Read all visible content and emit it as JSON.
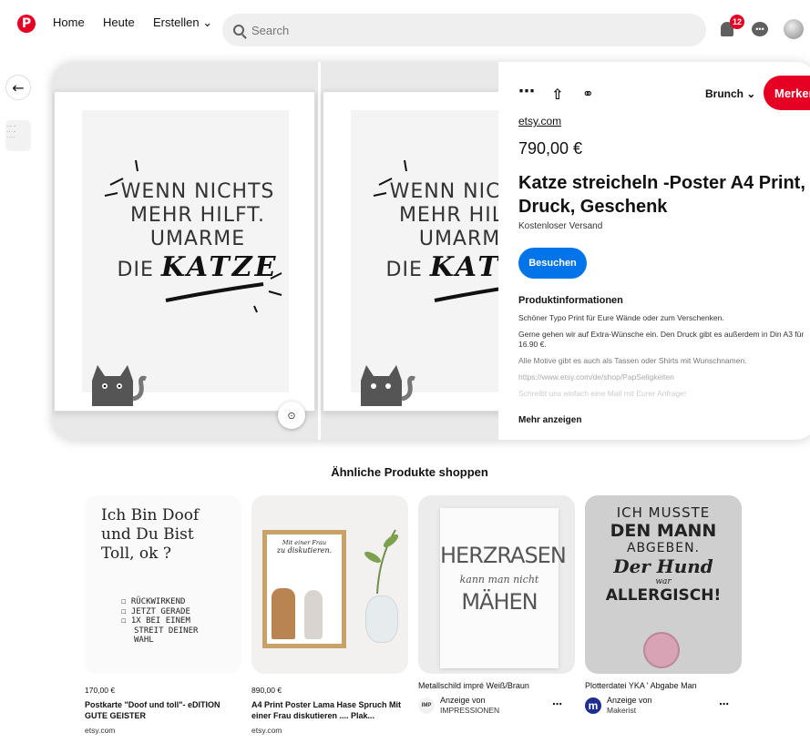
{
  "nav": {
    "home": "Home",
    "heute": "Heute",
    "erstellen": "Erstellen ⌄",
    "search_placeholder": "Search",
    "notification_count": "12"
  },
  "pin": {
    "board": "Brunch ⌄",
    "save": "Merken",
    "source": "etsy.com",
    "price": "790,00 €",
    "title": "Katze streicheln -Poster A4 Print, Druck, Geschenk",
    "shipping": "Kostenloser Versand",
    "visit": "Besuchen",
    "product_info_heading": "Produktinformationen",
    "description": [
      "Schöner Typo Print für Eure Wände oder zum Verschenken.",
      "Gerne gehen wir auf Extra-Wünsche ein. Den Druck gibt es außerdem in Din A3 für 16.90 €.",
      "Alle Motive gibt es auch als Tassen oder Shirts mit Wunschnamen.",
      "https://www.etsy.com/de/shop/PapSeligkeiten",
      "Schreibt uns einfach eine Mail mit Eurer Anfrage!"
    ],
    "show_more": "Mehr anzeigen",
    "poster_text": [
      "WENN NICHTS",
      "MEHR HILFT.",
      "UMARME",
      "DIE"
    ],
    "poster_katze": "KATZE"
  },
  "similar": {
    "title": "Ähnliche Produkte shoppen",
    "products": [
      {
        "price": "170,00 €",
        "name": "Postkarte \"Doof und toll\"- eDITION GUTE GEISTER",
        "site": "etsy.com",
        "img_lines": [
          "Ich Bin Doof",
          "und Du Bist",
          "Toll, ok ?",
          "☐ Rückwirkend",
          "☐ Jetzt Gerade",
          "☐ 1x Bei Einem",
          "Streit Deiner",
          "Wahl"
        ]
      },
      {
        "price": "890,00 €",
        "name": "A4 Print Poster Lama Hase Spruch Mit einer Frau diskutieren .... Plak...",
        "site": "etsy.com",
        "img_lines": [
          "Mit einer Frau",
          "zu diskutieren."
        ]
      },
      {
        "name": "Metallschild impré Weiß/Braun",
        "ad_label": "Anzeige von",
        "advertiser": "IMPRESSIONEN",
        "logo": "IMP",
        "img_lines": [
          "HERZRASEN",
          "kann man nicht",
          "MÄHEN"
        ]
      },
      {
        "name": "Plotterdatei YKA ' Abgabe Man",
        "ad_label": "Anzeige von",
        "advertiser": "Makerist",
        "logo": "m",
        "img_lines": [
          "ICH MUSSTE",
          "DEN MANN",
          "ABGEBEN.",
          "Der Hund",
          "war",
          "ALLERGISCH!"
        ]
      }
    ]
  },
  "colors": {
    "brand": "#e60023",
    "visit": "#0074e8"
  }
}
